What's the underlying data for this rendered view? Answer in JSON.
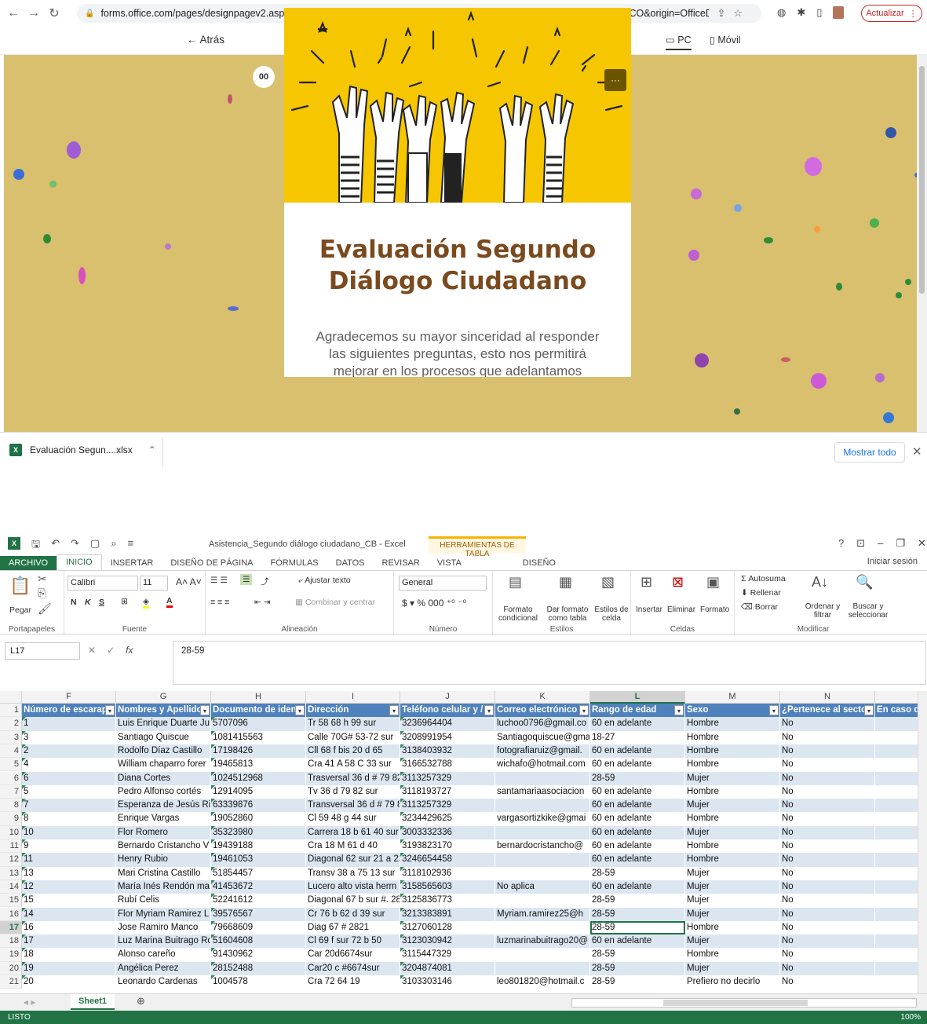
{
  "browser": {
    "url": "forms.office.com/pages/designpagev2.aspx?auth_pvr=OrgId&auth_upn=Nancy.Cely%40gobiernobogota.gov.co&lang=es-CO&origin=OfficeDotC...",
    "update_label": "Actualizar",
    "back_label": "Atrás",
    "view_pc_label": "PC",
    "view_mobile_label": "Móvil"
  },
  "form": {
    "title_line1": "Evaluación Segundo",
    "title_line2": "Diálogo Ciudadano",
    "description": "Agradecemos su mayor sinceridad al responder las siguientes preguntas, esto nos permitirá mejorar en los procesos que adelantamos",
    "more_glyph": "···",
    "immersive_glyph": "00"
  },
  "downloads": {
    "file_name": "Evaluación Segun....xlsx",
    "show_all_label": "Mostrar todo"
  },
  "excel": {
    "doc_title": "Asistencia_Segundo diálogo ciudadano_CB - Excel",
    "tools_label": "HERRAMIENTAS DE TABLA",
    "signin_label": "Iniciar sesión",
    "tabs": [
      "ARCHIVO",
      "INICIO",
      "INSERTAR",
      "DISEÑO DE PÁGINA",
      "FÓRMULAS",
      "DATOS",
      "REVISAR",
      "VISTA"
    ],
    "design_tab": "DISEÑO",
    "ribbon": {
      "paste_label": "Pegar",
      "clipboard_group": "Portapapeles",
      "font_name": "Calibri",
      "font_size": "11",
      "font_group": "Fuente",
      "wrap_text": "Ajustar texto",
      "merge_center": "Combinar y centrar",
      "alignment_group": "Alineación",
      "number_format": "General",
      "number_group": "Número",
      "cond_format": "Formato condicional",
      "format_table": "Dar formato como tabla",
      "cell_styles": "Estilos de celda",
      "styles_group": "Estilos",
      "insert": "Insertar",
      "delete": "Eliminar",
      "format": "Formato",
      "cells_group": "Celdas",
      "autosum": "Autosuma",
      "fill": "Rellenar",
      "clear": "Borrar",
      "sort_filter": "Ordenar y filtrar",
      "find_select": "Buscar y seleccionar",
      "editing_group": "Modificar"
    },
    "name_box": "L17",
    "formula": "28-59",
    "columns": [
      "F",
      "G",
      "H",
      "I",
      "J",
      "K",
      "L",
      "M",
      "N"
    ],
    "headers": [
      "Número de escarap",
      "Nombres y Apellido",
      "Documento de iden",
      "Dirección",
      "Teléfono celular y /",
      "Correo electrónico",
      "Rango de edad",
      "Sexo",
      "¿Pertenece al secto",
      "En caso d"
    ],
    "rows": [
      {
        "n": "2",
        "f": "1",
        "g": "Luis Enrique Duarte Ju",
        "h": "5707096",
        "i": "Tr 58 68 h 99 sur",
        "j": "3236964404",
        "k": "luchoo0796@gmail.co",
        "l": "60 en adelante",
        "m": "Hombre",
        "o": "No"
      },
      {
        "n": "3",
        "f": "3",
        "g": "Santiago Quiscue",
        "h": "1081415563",
        "i": "Calle 70G# 53-72 sur",
        "j": "3208991954",
        "k": "Santiagoquiscue@gma",
        "l": "18-27",
        "m": "Hombre",
        "o": "No"
      },
      {
        "n": "4",
        "f": "2",
        "g": "Rodolfo Díaz Castillo",
        "h": "17198426",
        "i": "Cll 68 f bis 20 d 65",
        "j": "3138403932",
        "k": "fotografiaruiz@gmail.",
        "l": "60 en adelante",
        "m": "Hombre",
        "o": "No"
      },
      {
        "n": "5",
        "f": "4",
        "g": "William chaparro forer",
        "h": "19465813",
        "i": "Cra 41 A 58 C 33 sur",
        "j": "3166532788",
        "k": "wichafo@hotmail.com",
        "l": "60 en adelante",
        "m": "Hombre",
        "o": "No"
      },
      {
        "n": "6",
        "f": "6",
        "g": "Diana Cortes",
        "h": "1024512968",
        "i": "Trasversal 36 d # 79 82",
        "j": "3113257329",
        "k": "",
        "l": "28-59",
        "m": "Mujer",
        "o": "No"
      },
      {
        "n": "7",
        "f": "5",
        "g": "Pedro Alfonso cortés",
        "h": "12914095",
        "i": "Tv 36 d 79 82 sur",
        "j": "3118193727",
        "k": "santamariaasociacion",
        "l": "60 en adelante",
        "m": "Hombre",
        "o": "No"
      },
      {
        "n": "8",
        "f": "7",
        "g": "Esperanza de Jesús Ria",
        "h": "63339876",
        "i": "Transversal 36 d # 79 8.",
        "j": "3113257329",
        "k": "",
        "l": "60 en adelante",
        "m": "Mujer",
        "o": "No"
      },
      {
        "n": "9",
        "f": "8",
        "g": "Enrique Vargas",
        "h": "19052860",
        "i": "Cl 59 48 g 44 sur",
        "j": "3234429625",
        "k": "vargasortizkike@gmai",
        "l": "60 en adelante",
        "m": "Hombre",
        "o": "No"
      },
      {
        "n": "10",
        "f": "10",
        "g": "Flor Romero",
        "h": "35323980",
        "i": "Carrera 18 b 61 40 sur",
        "j": "3003332336",
        "k": "",
        "l": "60 en adelante",
        "m": "Mujer",
        "o": "No"
      },
      {
        "n": "11",
        "f": "9",
        "g": "Bernardo Cristancho V",
        "h": "19439188",
        "i": "Cra 18 M 61 d 40",
        "j": "3193823170",
        "k": "bernardocristancho@",
        "l": "60 en adelante",
        "m": "Hombre",
        "o": "No"
      },
      {
        "n": "12",
        "f": "11",
        "g": "Henry Rubio",
        "h": "19461053",
        "i": "Diagonal 62 sur 21 a 23",
        "j": "3246654458",
        "k": "",
        "l": "60 en adelante",
        "m": "Hombre",
        "o": "No"
      },
      {
        "n": "13",
        "f": "13",
        "g": "Mari Cristina Castillo",
        "h": "51854457",
        "i": "Transv 38 a 75 13 sur",
        "j": "3118102936",
        "k": "",
        "l": "28-59",
        "m": "Mujer",
        "o": "No"
      },
      {
        "n": "14",
        "f": "12",
        "g": "María Inés Rendón ma",
        "h": "41453672",
        "i": "Lucero alto vista herm",
        "j": "3158565603",
        "k": "No aplica",
        "l": "60 en adelante",
        "m": "Mujer",
        "o": "No"
      },
      {
        "n": "15",
        "f": "15",
        "g": "Rubí Celis",
        "h": "52241612",
        "i": "Diagonal 67 b sur #. 28",
        "j": "3125836773",
        "k": "",
        "l": "28-59",
        "m": "Mujer",
        "o": "No"
      },
      {
        "n": "16",
        "f": "14",
        "g": "Flor Myriam Ramirez L",
        "h": "39576567",
        "i": "Cr 76 b 62 d 39 sur",
        "j": "3213383891",
        "k": "Myriam.ramirez25@h",
        "l": "28-59",
        "m": "Mujer",
        "o": "No"
      },
      {
        "n": "17",
        "f": "16",
        "g": "Jose Ramiro Manco",
        "h": "79668609",
        "i": "Diag 67 # 2821",
        "j": "3127060128",
        "k": "",
        "l": "28-59",
        "m": "Hombre",
        "o": "No"
      },
      {
        "n": "18",
        "f": "17",
        "g": "Luz Marina Buitrago Ro",
        "h": "51604608",
        "i": "Cl 69 f sur 72 b 50",
        "j": "3123030942",
        "k": "luzmarinabuitrago20@",
        "l": "60 en adelante",
        "m": "Mujer",
        "o": "No"
      },
      {
        "n": "19",
        "f": "18",
        "g": "Alonso careño",
        "h": "91430962",
        "i": "Car 20d6674sur",
        "j": "3115447329",
        "k": "",
        "l": "28-59",
        "m": "Hombre",
        "o": "No"
      },
      {
        "n": "20",
        "f": "19",
        "g": "Angélica Perez",
        "h": "28152488",
        "i": "Car20 c #6674sur",
        "j": "3204874081",
        "k": "",
        "l": "28-59",
        "m": "Mujer",
        "o": "No"
      },
      {
        "n": "21",
        "f": "20",
        "g": "Leonardo Cardenas",
        "h": "1004578",
        "i": "Cra 72 64 19",
        "j": "3103303146",
        "k": "leo801820@hotmail.c",
        "l": "28-59",
        "m": "Prefiero no decirlo",
        "o": "No"
      }
    ],
    "sheet_name": "Sheet1",
    "status": "LISTO",
    "zoom": "100%"
  }
}
